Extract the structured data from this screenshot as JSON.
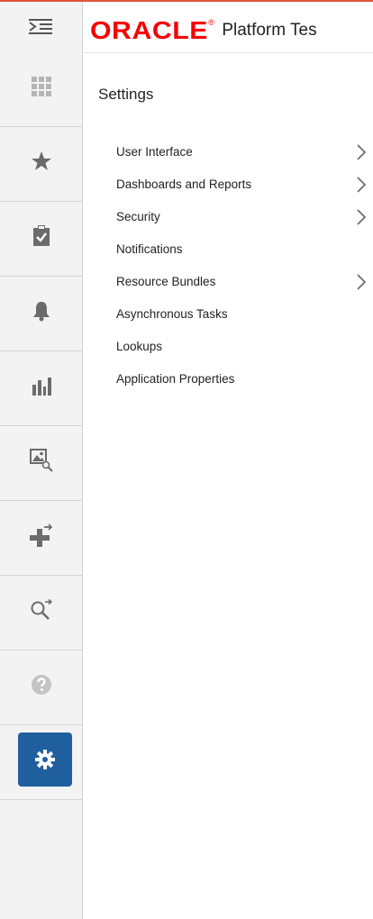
{
  "brand": {
    "logo_text": "ORACLE",
    "registered_mark": "®",
    "product_name": "Platform Tes",
    "accent_color": "#f80000"
  },
  "header": {
    "menu_icon": "collapse-menu-icon"
  },
  "sidebar": {
    "items": [
      {
        "icon": "grid-icon",
        "label": "Home",
        "active": false
      },
      {
        "icon": "star-icon",
        "label": "Favorites",
        "active": false
      },
      {
        "icon": "clipboard-check-icon",
        "label": "Tasks",
        "active": false
      },
      {
        "icon": "bell-icon",
        "label": "Notifications",
        "active": false
      },
      {
        "icon": "bar-chart-icon",
        "label": "Reports",
        "active": false
      },
      {
        "icon": "image-search-icon",
        "label": "Search Images",
        "active": false
      },
      {
        "icon": "plus-icon",
        "label": "Create",
        "active": false
      },
      {
        "icon": "magnifier-icon",
        "label": "Search",
        "active": false
      },
      {
        "icon": "help-icon",
        "label": "Help",
        "active": false
      },
      {
        "icon": "gear-icon",
        "label": "Settings",
        "active": true
      }
    ],
    "active_color": "#1f5f9e"
  },
  "main": {
    "title": "Settings",
    "items": [
      {
        "label": "User Interface",
        "has_children": true
      },
      {
        "label": "Dashboards and Reports",
        "has_children": true
      },
      {
        "label": "Security",
        "has_children": true
      },
      {
        "label": "Notifications",
        "has_children": false
      },
      {
        "label": "Resource Bundles",
        "has_children": true
      },
      {
        "label": "Asynchronous Tasks",
        "has_children": false
      },
      {
        "label": "Lookups",
        "has_children": false
      },
      {
        "label": "Application Properties",
        "has_children": false
      }
    ]
  }
}
